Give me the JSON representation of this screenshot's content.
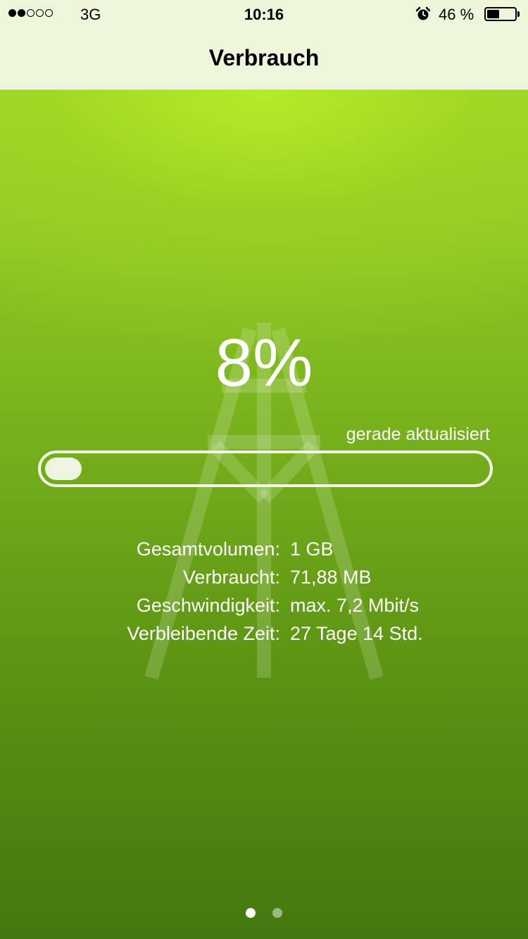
{
  "status_bar": {
    "signal_total": 5,
    "signal_filled": 2,
    "carrier": "3G",
    "time": "10:16",
    "alarm_icon": "alarm-clock-icon",
    "battery_percent_text": "46 %",
    "battery_level": 0.46
  },
  "nav": {
    "title": "Verbrauch"
  },
  "usage": {
    "percent_text": "8%",
    "percent_value": 8,
    "updated_text": "gerade aktualisiert",
    "details": [
      {
        "label": "Gesamtvolumen:",
        "value": "1 GB"
      },
      {
        "label": "Verbraucht:",
        "value": "71,88 MB"
      },
      {
        "label": "Geschwindigkeit:",
        "value": "max. 7,2 Mbit/s"
      },
      {
        "label": "Verbleibende Zeit:",
        "value": "27 Tage 14 Std."
      }
    ]
  },
  "pager": {
    "total": 2,
    "active": 0
  },
  "colors": {
    "nav_background": "#eef6d9",
    "gradient_top": "#a4d62a",
    "gradient_bottom": "#437810",
    "text": "#ffffff"
  }
}
